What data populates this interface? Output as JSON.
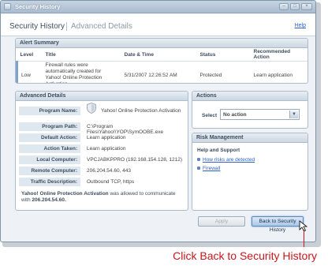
{
  "window": {
    "title": "Security History",
    "controls": {
      "minimize": "–",
      "maximize": "□",
      "close": "×"
    }
  },
  "header": {
    "title": "Security History",
    "subtitle": "Advanced Details",
    "help": "Help"
  },
  "alert_summary": {
    "heading": "Alert Summary",
    "columns": [
      "Level",
      "Title",
      "Date & Time",
      "Status",
      "Recommended Action"
    ],
    "row": {
      "level": "Low",
      "title": "Firewall rules were automatically created for Yahoo! Online Protection Activation",
      "datetime": "5/31/2007 12:26:52 AM",
      "status": "Protected",
      "action": "Learn application"
    }
  },
  "advanced_details": {
    "heading": "Advanced Details",
    "fields": [
      {
        "label": "Program Name:",
        "value": "Yahoo! Online Protection Activation"
      },
      {
        "label": "Program Path:",
        "value": "C:\\Program Files\\Yahoo!\\YOP\\SymOOBE.exe"
      },
      {
        "label": "Default Action:",
        "value": "Learn application"
      },
      {
        "label": "Action Taken:",
        "value": "Learn application"
      },
      {
        "label": "Local Computer:",
        "value": "VPCJABKPPRO (192.168.154.128, 1212)"
      },
      {
        "label": "Remote Computer:",
        "value": "206.204.54.60, 443"
      },
      {
        "label": "Traffic Description:",
        "value": "Outbound TCP, https"
      }
    ],
    "note_bold": "Yahoo! Online Protection Activation",
    "note_text": " was allowed to communicate with ",
    "note_ip": "206.204.54.60."
  },
  "actions": {
    "heading": "Actions",
    "select_label": "Select",
    "select_value": "No action"
  },
  "risk": {
    "heading": "Risk Management",
    "subheading": "Help and Support",
    "links": [
      "How risks are detected",
      "Firewall"
    ]
  },
  "buttons": {
    "apply": "Apply",
    "back": "Back to Security History"
  },
  "callout": "Click Back to Security History",
  "colors": {
    "accent": "#2c62c7",
    "callout": "#c8171e"
  }
}
